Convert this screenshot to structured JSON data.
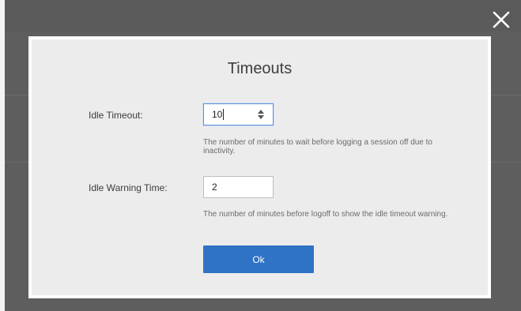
{
  "dialog": {
    "title": "Timeouts",
    "close_icon": "close-icon",
    "ok_label": "Ok",
    "colors": {
      "overlay": "#5e5e5e",
      "panel": "#ececec",
      "accent": "#2f73c5"
    }
  },
  "fields": {
    "idle_timeout": {
      "label": "Idle Timeout:",
      "value": "10",
      "help": "The number of minutes to wait before logging a session off due to inactivity.",
      "icon": "spinner-icon"
    },
    "idle_warning": {
      "label": "Idle Warning Time:",
      "value": "2",
      "help": "The number of minutes before logoff to show the idle timeout warning."
    }
  }
}
